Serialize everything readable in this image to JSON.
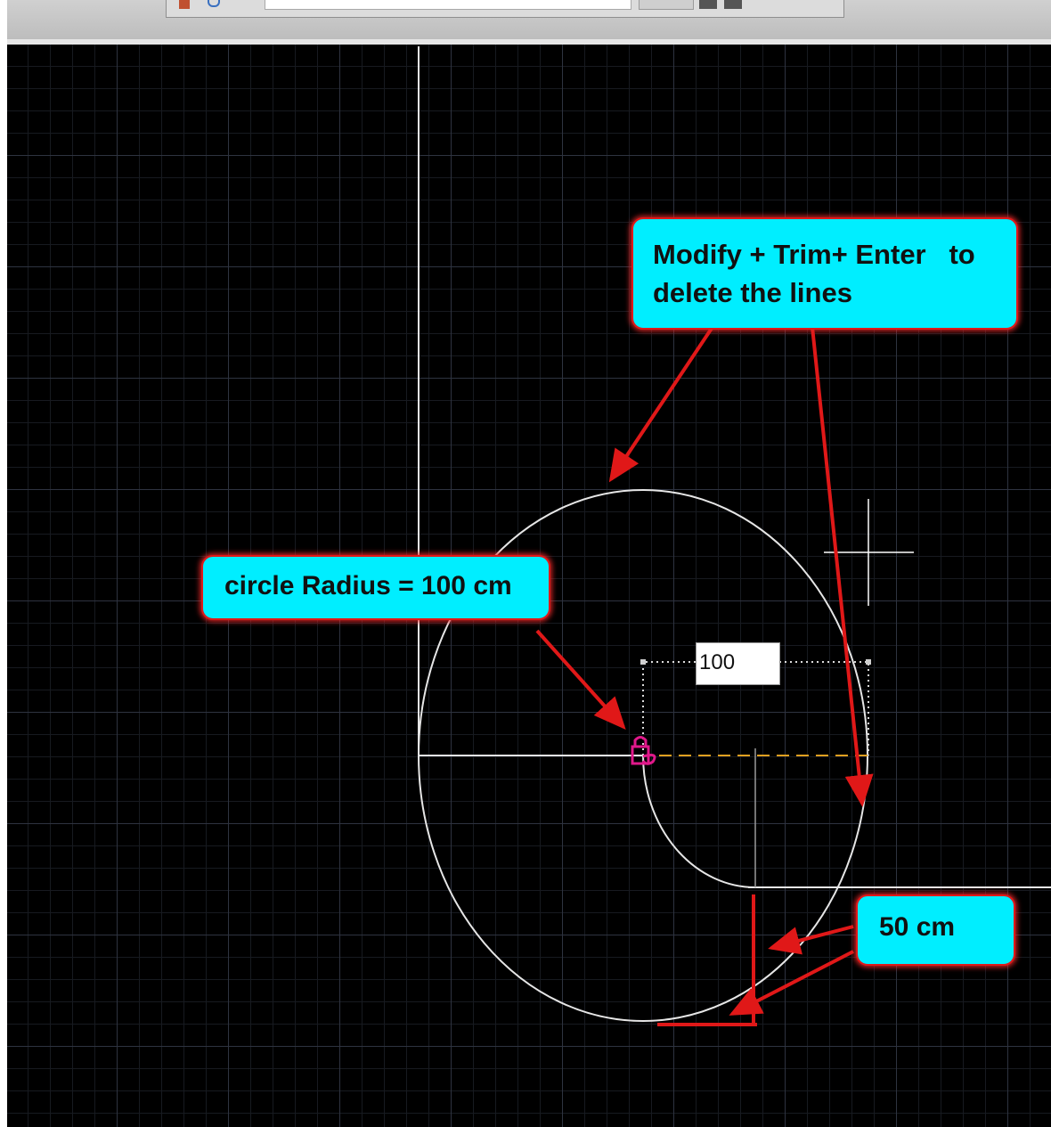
{
  "toolbar": {
    "icons": [
      "draw-tool-icon",
      "undo-icon"
    ]
  },
  "drawing": {
    "dimension_input_value": "100",
    "colors": {
      "background": "#000000",
      "geometry": "#ffffff",
      "annotation": "#e01818",
      "callout_fill": "#00eeff",
      "center_marker": "#e0188a",
      "ortho_track": "#e0a020"
    }
  },
  "callouts": {
    "trim_line1": "Modify + Trim+ Enter   to",
    "trim_line2": "delete the lines",
    "radius": "circle Radius = 100 cm",
    "fifty": "50 cm"
  }
}
